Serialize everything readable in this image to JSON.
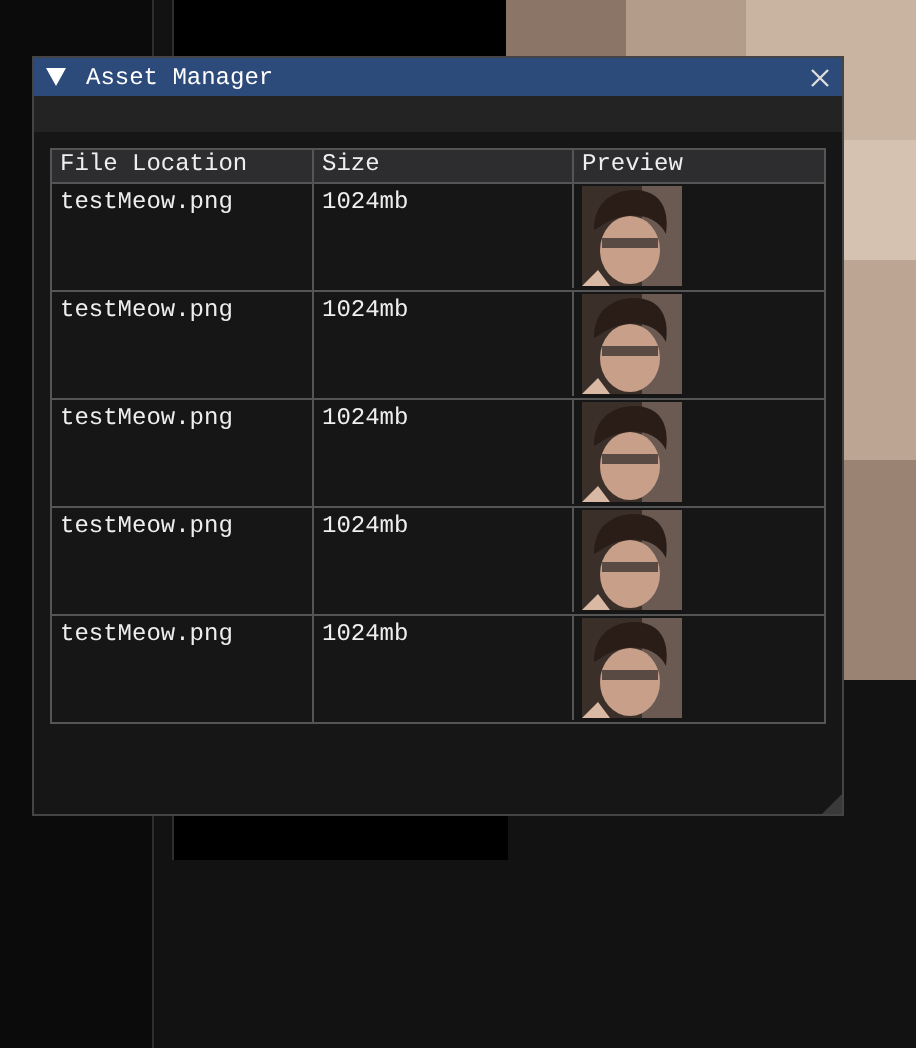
{
  "window": {
    "title": "Asset Manager"
  },
  "table": {
    "columns": [
      "File Location",
      "Size",
      "Preview"
    ],
    "rows": [
      {
        "file": "testMeow.png",
        "size": "1024mb"
      },
      {
        "file": "testMeow.png",
        "size": "1024mb"
      },
      {
        "file": "testMeow.png",
        "size": "1024mb"
      },
      {
        "file": "testMeow.png",
        "size": "1024mb"
      },
      {
        "file": "testMeow.png",
        "size": "1024mb"
      }
    ]
  }
}
